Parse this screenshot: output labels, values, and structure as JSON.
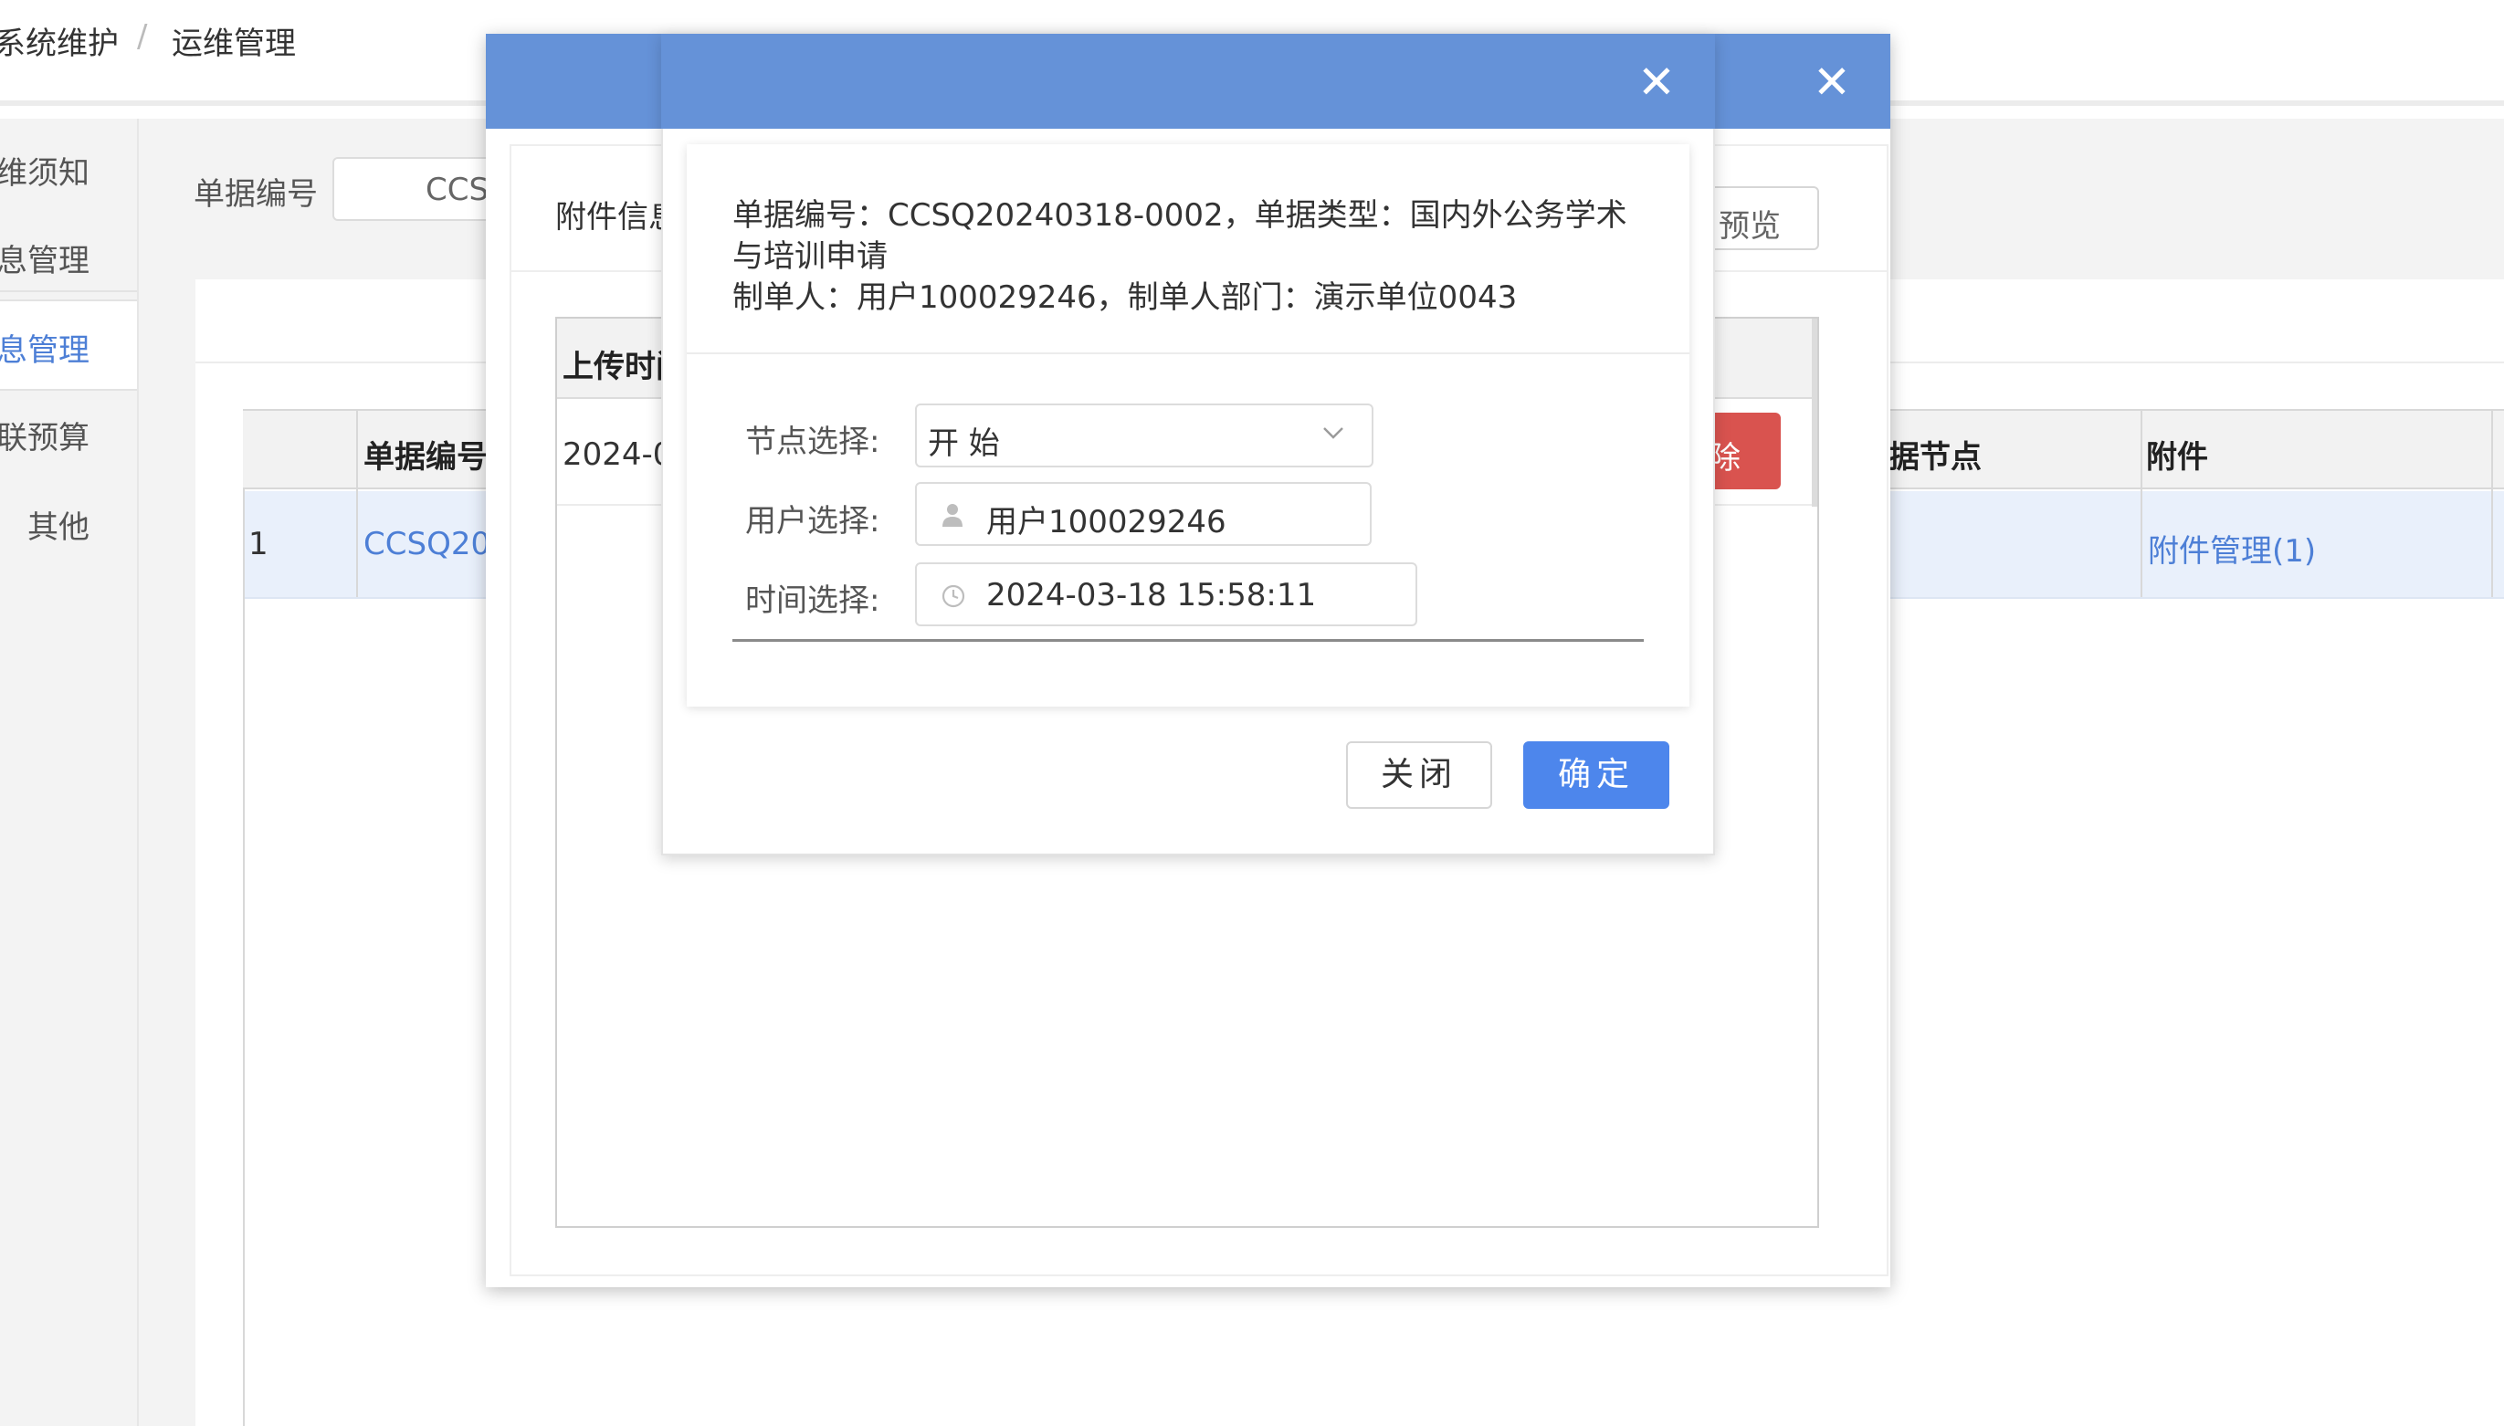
{
  "breadcrumb": {
    "item1": "系统维护",
    "separator": "/",
    "item2": "运维管理"
  },
  "sidebar": {
    "items": [
      {
        "label": "维须知"
      },
      {
        "label": "息管理"
      },
      {
        "label": "息管理"
      },
      {
        "label": "联预算"
      },
      {
        "label": "其他"
      }
    ]
  },
  "filter": {
    "label": "单据编号",
    "value": "CCS"
  },
  "table": {
    "headers": {
      "doc_no": "单据编号",
      "node": "据节点",
      "attachment": "附件"
    },
    "rows": [
      {
        "index": "1",
        "doc_no": "CCSQ20",
        "attachment": "附件管理(1)"
      }
    ]
  },
  "attachment_modal": {
    "label": "附件信息",
    "preview_button": "预览",
    "table_header": "上传时间",
    "row_date": "2024-0",
    "delete_button": "除"
  },
  "node_modal": {
    "info_line1": "单据编号：CCSQ20240318-0002，单据类型：国内外公务学术",
    "info_line2": "与培训申请",
    "info_line3": "制单人：用户100029246，制单人部门：演示单位0043",
    "node_label": "节点选择:",
    "node_value": "开 始",
    "user_label": "用户选择:",
    "user_value": "用户100029246",
    "time_label": "时间选择:",
    "time_value": "2024-03-18 15:58:11",
    "close_button": "关闭",
    "ok_button": "确定"
  },
  "colors": {
    "header_blue": "#6592d8",
    "primary": "#4d86ec",
    "danger": "#d9534f",
    "link": "#4d7fd6"
  }
}
